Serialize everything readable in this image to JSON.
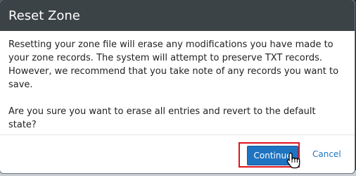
{
  "dialog": {
    "title": "Reset Zone",
    "paragraph1": "Resetting your zone file will erase any modifications you have made to your zone records. The system will attempt to preserve TXT records. However, we recommend that you take note of any records you want to save.",
    "paragraph2": "Are you sure you want to erase all entries and revert to the default state?",
    "continue_label": "Continue",
    "cancel_label": "Cancel"
  },
  "colors": {
    "header_bg": "#3c4347",
    "primary": "#1f74c2",
    "highlight": "#e0141e"
  },
  "icons": {
    "cursor": "hand-pointer-icon"
  }
}
